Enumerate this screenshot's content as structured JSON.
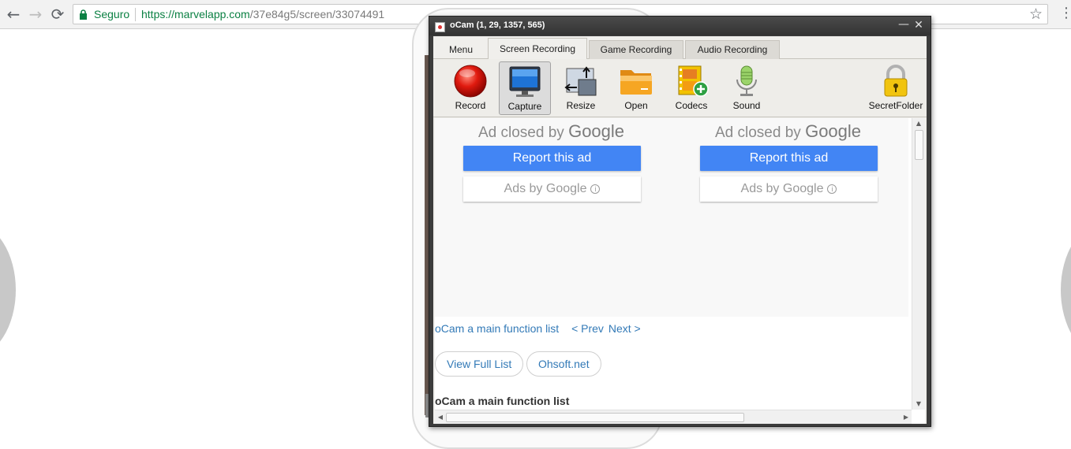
{
  "browser": {
    "secure_label": "Seguro",
    "url_host": "https://marvelapp.com",
    "url_path": "/37e84g5/screen/33074491",
    "back_glyph": "←",
    "forward_glyph": "→",
    "reload_glyph": "⟳",
    "star_glyph": "☆",
    "menu_glyph": "⋮"
  },
  "ocam": {
    "title": "oCam (1, 29, 1357, 565)",
    "minimize_glyph": "—",
    "close_glyph": "✕",
    "tabs": [
      {
        "label": "Menu"
      },
      {
        "label": "Screen Recording"
      },
      {
        "label": "Game Recording"
      },
      {
        "label": "Audio Recording"
      }
    ],
    "active_tab": "Screen Recording",
    "ribbon": [
      {
        "label": "Record",
        "icon": "record-icon"
      },
      {
        "label": "Capture",
        "icon": "monitor-icon"
      },
      {
        "label": "Resize",
        "icon": "resize-icon"
      },
      {
        "label": "Open",
        "icon": "folder-icon"
      },
      {
        "label": "Codecs",
        "icon": "film-add-icon"
      },
      {
        "label": "Sound",
        "icon": "microphone-icon"
      },
      {
        "label": "SecretFolder",
        "icon": "padlock-icon"
      }
    ],
    "active_button": "Capture"
  },
  "content": {
    "ads": [
      {
        "closed_prefix": "Ad closed by ",
        "closed_brand": "Google",
        "report_label": "Report this ad",
        "adsby_label": "Ads by Google"
      },
      {
        "closed_prefix": "Ad closed by ",
        "closed_brand": "Google",
        "report_label": "Report this ad",
        "adsby_label": "Ads by Google"
      }
    ],
    "info_glyph": "i",
    "nav_link": "oCam a main function list",
    "prev_link": "< Prev",
    "next_link": "Next >",
    "view_full_list": "View Full List",
    "ohsoft": "Ohsoft.net",
    "section_heading": "oCam a main function list"
  },
  "colors": {
    "link": "#337ab7",
    "report_button": "#4285f4",
    "secure_green": "#0b8043"
  }
}
